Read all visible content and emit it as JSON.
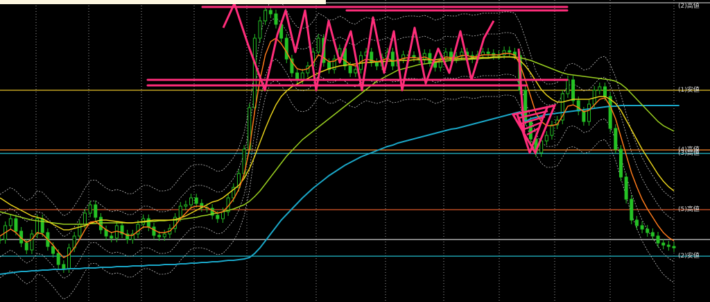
{
  "chart_data": {
    "type": "line",
    "title": "",
    "ylim": [
      0,
      435
    ],
    "grid": "dotted vertical",
    "colors": {
      "candle_up": "#25c225",
      "ma_fast": "#ff7a1a",
      "ma_mid": "#e8d21a",
      "ma_slow": "#9ad020",
      "ma_long": "#1aa7c8",
      "bollinger": "#c8c8c8",
      "annotation": "#ff2d7a"
    },
    "levels": [
      {
        "label": "(2)高値",
        "y": 431,
        "color": "#bbbbbb"
      },
      {
        "label": "(1)安値",
        "y": 305,
        "color": "#e8c22a"
      },
      {
        "label": "(4)高値",
        "y": 219,
        "color": "#ff8a2a"
      },
      {
        "label": "(3)高値",
        "y": 214,
        "color": "#23c0d0"
      },
      {
        "label": "(5)高値",
        "y": 133,
        "color": "#e05a2a"
      },
      {
        "label": "",
        "y": 90,
        "color": "#cccccc"
      },
      {
        "label": "(2)安値",
        "y": 66,
        "color": "#23c0d0"
      }
    ],
    "price": [
      90,
      110,
      120,
      102,
      85,
      75,
      98,
      120,
      100,
      80,
      70,
      54,
      48,
      78,
      95,
      112,
      128,
      140,
      122,
      104,
      95,
      92,
      110,
      98,
      90,
      98,
      112,
      120,
      108,
      96,
      94,
      98,
      106,
      122,
      138,
      140,
      150,
      142,
      136,
      135,
      125,
      120,
      130,
      150,
      165,
      185,
      220,
      280,
      380,
      405,
      420,
      415,
      400,
      380,
      350,
      330,
      320,
      330,
      340,
      360,
      380,
      345,
      335,
      350,
      365,
      340,
      330,
      335,
      355,
      360,
      345,
      340,
      352,
      360,
      340,
      350,
      356,
      355,
      352,
      350,
      358,
      345,
      338,
      350,
      360,
      350,
      354,
      360,
      355,
      350,
      356,
      360,
      358,
      355,
      356,
      362,
      360,
      355,
      305,
      260,
      235,
      215,
      232,
      240,
      255,
      262,
      300,
      320,
      290,
      275,
      260,
      285,
      305,
      310,
      296,
      250,
      220,
      180,
      148,
      118,
      110,
      105,
      100,
      95,
      85,
      82,
      80,
      78
    ],
    "ma_fast": [
      95,
      100,
      105,
      100,
      92,
      86,
      90,
      100,
      98,
      90,
      82,
      72,
      64,
      68,
      78,
      90,
      104,
      115,
      116,
      110,
      104,
      100,
      102,
      100,
      96,
      96,
      102,
      108,
      108,
      104,
      100,
      100,
      102,
      110,
      120,
      128,
      136,
      138,
      138,
      136,
      132,
      128,
      130,
      138,
      148,
      162,
      184,
      220,
      275,
      320,
      356,
      375,
      380,
      372,
      360,
      346,
      336,
      334,
      336,
      344,
      356,
      352,
      346,
      347,
      352,
      348,
      342,
      340,
      346,
      350,
      348,
      346,
      348,
      351,
      347,
      348,
      351,
      352,
      352,
      351,
      353,
      350,
      346,
      348,
      353,
      352,
      352,
      355,
      355,
      353,
      354,
      356,
      356,
      356,
      356,
      358,
      358,
      356,
      342,
      320,
      296,
      272,
      260,
      254,
      254,
      256,
      268,
      282,
      284,
      280,
      274,
      276,
      284,
      292,
      294,
      282,
      264,
      238,
      212,
      186,
      166,
      148,
      134,
      122,
      110,
      100,
      93,
      88
    ],
    "ma_mid": [
      150,
      145,
      140,
      136,
      132,
      128,
      124,
      122,
      120,
      116,
      112,
      108,
      104,
      104,
      106,
      108,
      110,
      113,
      116,
      118,
      118,
      117,
      116,
      115,
      114,
      114,
      115,
      116,
      117,
      118,
      118,
      118,
      118,
      119,
      121,
      124,
      128,
      132,
      136,
      140,
      144,
      146,
      150,
      156,
      162,
      168,
      178,
      192,
      210,
      230,
      250,
      268,
      284,
      296,
      304,
      310,
      314,
      318,
      322,
      326,
      330,
      333,
      336,
      338,
      340,
      341,
      342,
      343,
      344,
      345,
      345,
      346,
      346,
      347,
      347,
      348,
      348,
      348,
      349,
      349,
      349,
      349,
      349,
      350,
      350,
      350,
      350,
      351,
      351,
      351,
      352,
      352,
      352,
      353,
      353,
      353,
      353,
      352,
      348,
      340,
      330,
      318,
      306,
      298,
      292,
      288,
      288,
      290,
      292,
      292,
      292,
      292,
      294,
      296,
      296,
      292,
      286,
      276,
      262,
      248,
      234,
      220,
      208,
      196,
      184,
      174,
      166,
      160
    ],
    "ma_slow": [
      130,
      128,
      126,
      124,
      122,
      120,
      118,
      117,
      116,
      115,
      114,
      113,
      112,
      112,
      112,
      112,
      112,
      113,
      113,
      114,
      114,
      114,
      114,
      114,
      114,
      114,
      115,
      115,
      116,
      116,
      117,
      117,
      118,
      118,
      119,
      120,
      121,
      122,
      124,
      125,
      127,
      128,
      130,
      132,
      134,
      137,
      140,
      145,
      152,
      160,
      170,
      180,
      190,
      200,
      210,
      218,
      226,
      234,
      240,
      246,
      252,
      258,
      264,
      270,
      276,
      282,
      288,
      294,
      300,
      306,
      312,
      318,
      322,
      326,
      330,
      334,
      336,
      338,
      340,
      342,
      343,
      344,
      345,
      346,
      347,
      348,
      348,
      349,
      349,
      350,
      350,
      351,
      351,
      352,
      352,
      353,
      353,
      353,
      352,
      350,
      348,
      345,
      342,
      339,
      336,
      333,
      330,
      328,
      327,
      326,
      325,
      324,
      323,
      322,
      321,
      320,
      318,
      314,
      308,
      300,
      292,
      284,
      276,
      268,
      260,
      254,
      250,
      246
    ],
    "ma_long": [
      40,
      41,
      42,
      43,
      44,
      44,
      45,
      45,
      46,
      46,
      47,
      47,
      47,
      48,
      48,
      48,
      49,
      49,
      49,
      50,
      50,
      50,
      51,
      51,
      51,
      52,
      52,
      52,
      53,
      53,
      53,
      54,
      54,
      54,
      55,
      55,
      56,
      56,
      57,
      57,
      58,
      58,
      59,
      60,
      60,
      61,
      62,
      64,
      70,
      78,
      88,
      98,
      108,
      118,
      126,
      134,
      142,
      150,
      157,
      164,
      170,
      176,
      182,
      187,
      192,
      197,
      201,
      205,
      209,
      212,
      215,
      218,
      221,
      224,
      226,
      229,
      231,
      233,
      235,
      237,
      239,
      241,
      243,
      245,
      247,
      249,
      250,
      252,
      254,
      256,
      258,
      260,
      262,
      264,
      266,
      268,
      270,
      272,
      274,
      260,
      264,
      266,
      268,
      270,
      271,
      272,
      273,
      274,
      275,
      276,
      277,
      278,
      279,
      280,
      281,
      282,
      282,
      283,
      283,
      283,
      283,
      283,
      283,
      283,
      283,
      283,
      283,
      283,
      283
    ],
    "annotations": {
      "range_lines": [
        {
          "x1": 292,
          "x2": 818,
          "y": 425
        },
        {
          "x1": 500,
          "x2": 818,
          "y": 420
        },
        {
          "x1": 213,
          "x2": 818,
          "y": 320
        },
        {
          "x1": 213,
          "x2": 760,
          "y": 312
        }
      ],
      "zigzag": [
        [
          322,
          395
        ],
        [
          338,
          430
        ],
        [
          358,
          370
        ],
        [
          382,
          305
        ],
        [
          400,
          385
        ],
        [
          412,
          420
        ],
        [
          426,
          360
        ],
        [
          440,
          420
        ],
        [
          456,
          305
        ],
        [
          474,
          405
        ],
        [
          490,
          345
        ],
        [
          506,
          390
        ],
        [
          522,
          305
        ],
        [
          538,
          410
        ],
        [
          554,
          330
        ],
        [
          568,
          390
        ],
        [
          580,
          305
        ],
        [
          598,
          395
        ],
        [
          614,
          315
        ],
        [
          632,
          365
        ],
        [
          648,
          330
        ],
        [
          664,
          390
        ],
        [
          680,
          320
        ],
        [
          698,
          380
        ],
        [
          712,
          405
        ]
      ],
      "drop": [
        [
          748,
          365
        ],
        [
          752,
          300
        ],
        [
          756,
          245
        ],
        [
          746,
          270
        ],
        [
          764,
          215
        ],
        [
          784,
          268
        ],
        [
          790,
          282
        ]
      ]
    }
  }
}
